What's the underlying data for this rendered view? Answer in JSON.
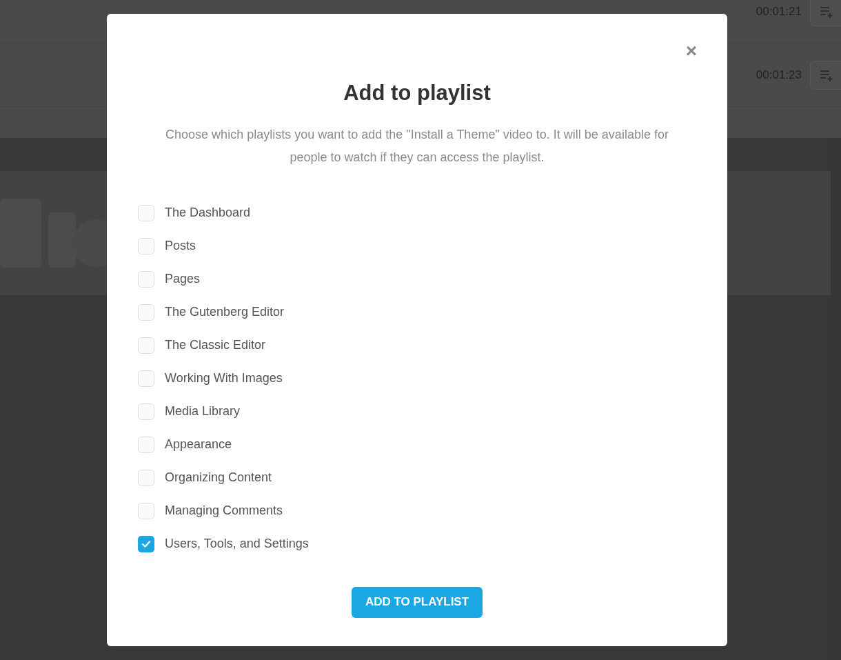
{
  "background_list": {
    "rows": [
      {
        "time": "00:01:21"
      },
      {
        "time": "00:01:23"
      }
    ]
  },
  "dialog": {
    "close": "×",
    "title": "Add to playlist",
    "description": "Choose which playlists you want to add the \"Install a Theme\" video to. It will be available for people to watch if they can access the playlist.",
    "playlists": [
      {
        "label": "The Dashboard",
        "checked": false
      },
      {
        "label": "Posts",
        "checked": false
      },
      {
        "label": "Pages",
        "checked": false
      },
      {
        "label": "The Gutenberg Editor",
        "checked": false
      },
      {
        "label": "The Classic Editor",
        "checked": false
      },
      {
        "label": "Working With Images",
        "checked": false
      },
      {
        "label": "Media Library",
        "checked": false
      },
      {
        "label": "Appearance",
        "checked": false
      },
      {
        "label": "Organizing Content",
        "checked": false
      },
      {
        "label": "Managing Comments",
        "checked": false
      },
      {
        "label": "Users, Tools, and Settings",
        "checked": true
      }
    ],
    "button": "ADD TO PLAYLIST"
  }
}
